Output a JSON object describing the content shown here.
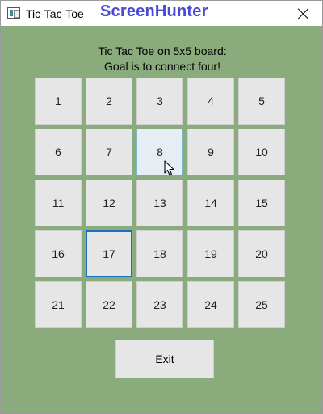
{
  "window": {
    "title": "Tic-Tac-Toe",
    "watermark": "ScreenHunter",
    "icon": "app-window-icon",
    "close_icon": "close-icon"
  },
  "instructions": {
    "line1": "Tic Tac Toe on 5x5 board:",
    "line2": "Goal is to connect four!"
  },
  "board": {
    "cells": [
      "1",
      "2",
      "3",
      "4",
      "5",
      "6",
      "7",
      "8",
      "9",
      "10",
      "11",
      "12",
      "13",
      "14",
      "15",
      "16",
      "17",
      "18",
      "19",
      "20",
      "21",
      "22",
      "23",
      "24",
      "25"
    ],
    "hovered_cell": "8",
    "focused_cell": "17"
  },
  "exit_label": "Exit",
  "colors": {
    "background": "#8aab7b",
    "cell": "#e6e6e6",
    "focus_border": "#1c6fc4",
    "watermark": "#4a4ad8"
  }
}
